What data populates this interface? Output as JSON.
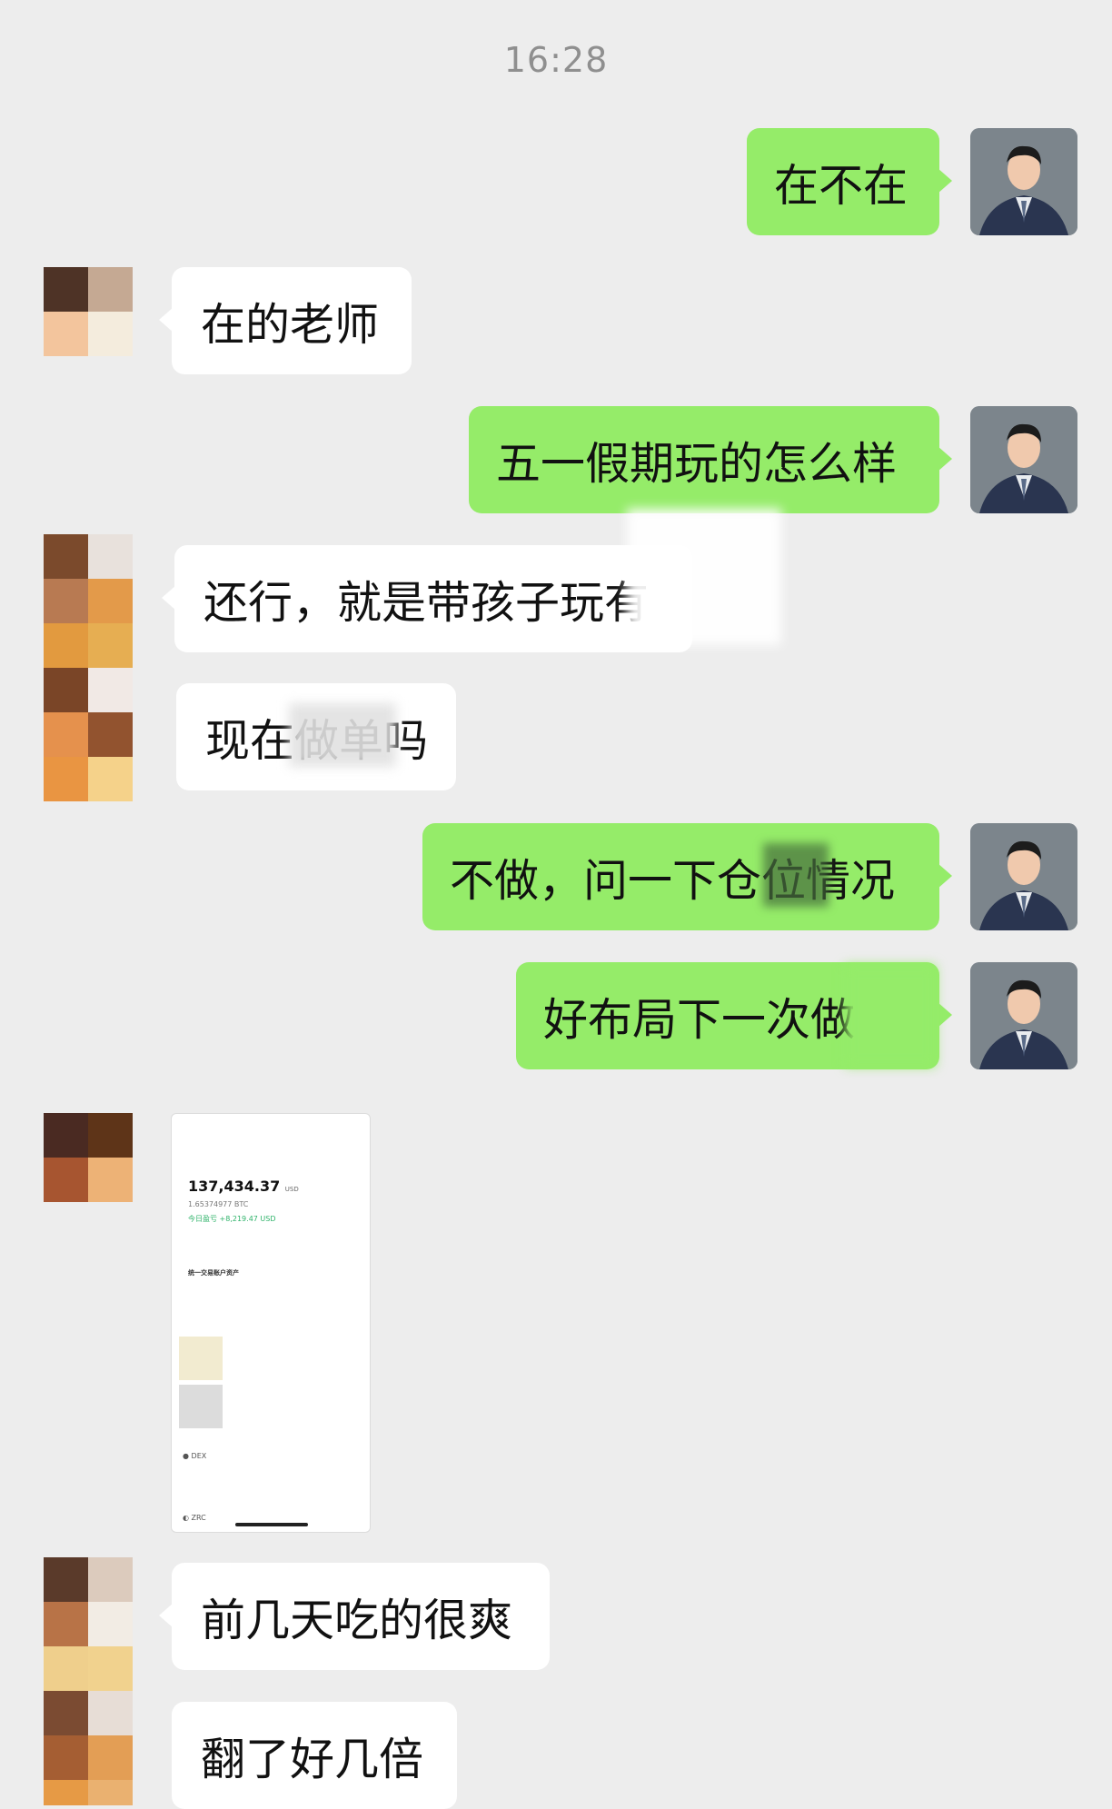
{
  "timestamp": "16:28",
  "messages": [
    {
      "side": "me",
      "text": "在不在"
    },
    {
      "side": "them",
      "text": "在的老师"
    },
    {
      "side": "me",
      "text": "五一假期玩的怎么样"
    },
    {
      "side": "them",
      "text": "还行，就是带孩子玩有"
    },
    {
      "side": "them",
      "text": "现在做单吗"
    },
    {
      "side": "me",
      "text": "不做，问一下仓位情况"
    },
    {
      "side": "me",
      "text": "好布局下一次做"
    },
    {
      "side": "them",
      "type": "image",
      "image_total": "137,434.37",
      "image_currency": "USD",
      "image_btc": "1.65374977 BTC",
      "image_today": "今日盈亏 +8,219.47 USD",
      "image_section": "统一交易账户资产",
      "image_row1": "DEX",
      "image_row2": "ZRC"
    },
    {
      "side": "them",
      "text": "前几天吃的很爽"
    },
    {
      "side": "them",
      "text": "翻了好几倍"
    }
  ],
  "colors": {
    "my_bubble": "#95ec69",
    "their_bubble": "#ffffff",
    "background": "#ededed"
  }
}
